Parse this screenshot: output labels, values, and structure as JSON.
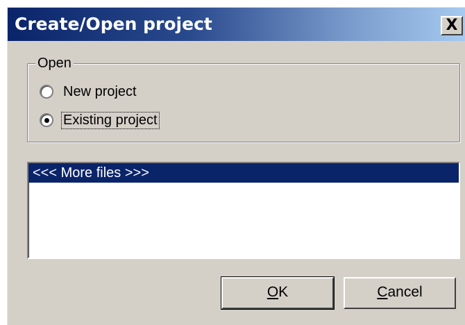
{
  "dialog": {
    "title": "Create/Open project",
    "close_label": "X"
  },
  "open_group": {
    "label": "Open",
    "options": [
      {
        "label": "New project",
        "selected": false
      },
      {
        "label": "Existing project",
        "selected": true
      }
    ]
  },
  "files_list": {
    "items": [
      {
        "label": "<<< More files >>>",
        "selected": true
      }
    ]
  },
  "buttons": {
    "ok": {
      "mnemonic": "O",
      "rest": "K"
    },
    "cancel": {
      "mnemonic": "C",
      "rest": "ancel"
    }
  },
  "colors": {
    "title_start": "#0a246a",
    "title_end": "#a6caf0",
    "selection": "#0a246a",
    "face": "#d4d0c8"
  }
}
